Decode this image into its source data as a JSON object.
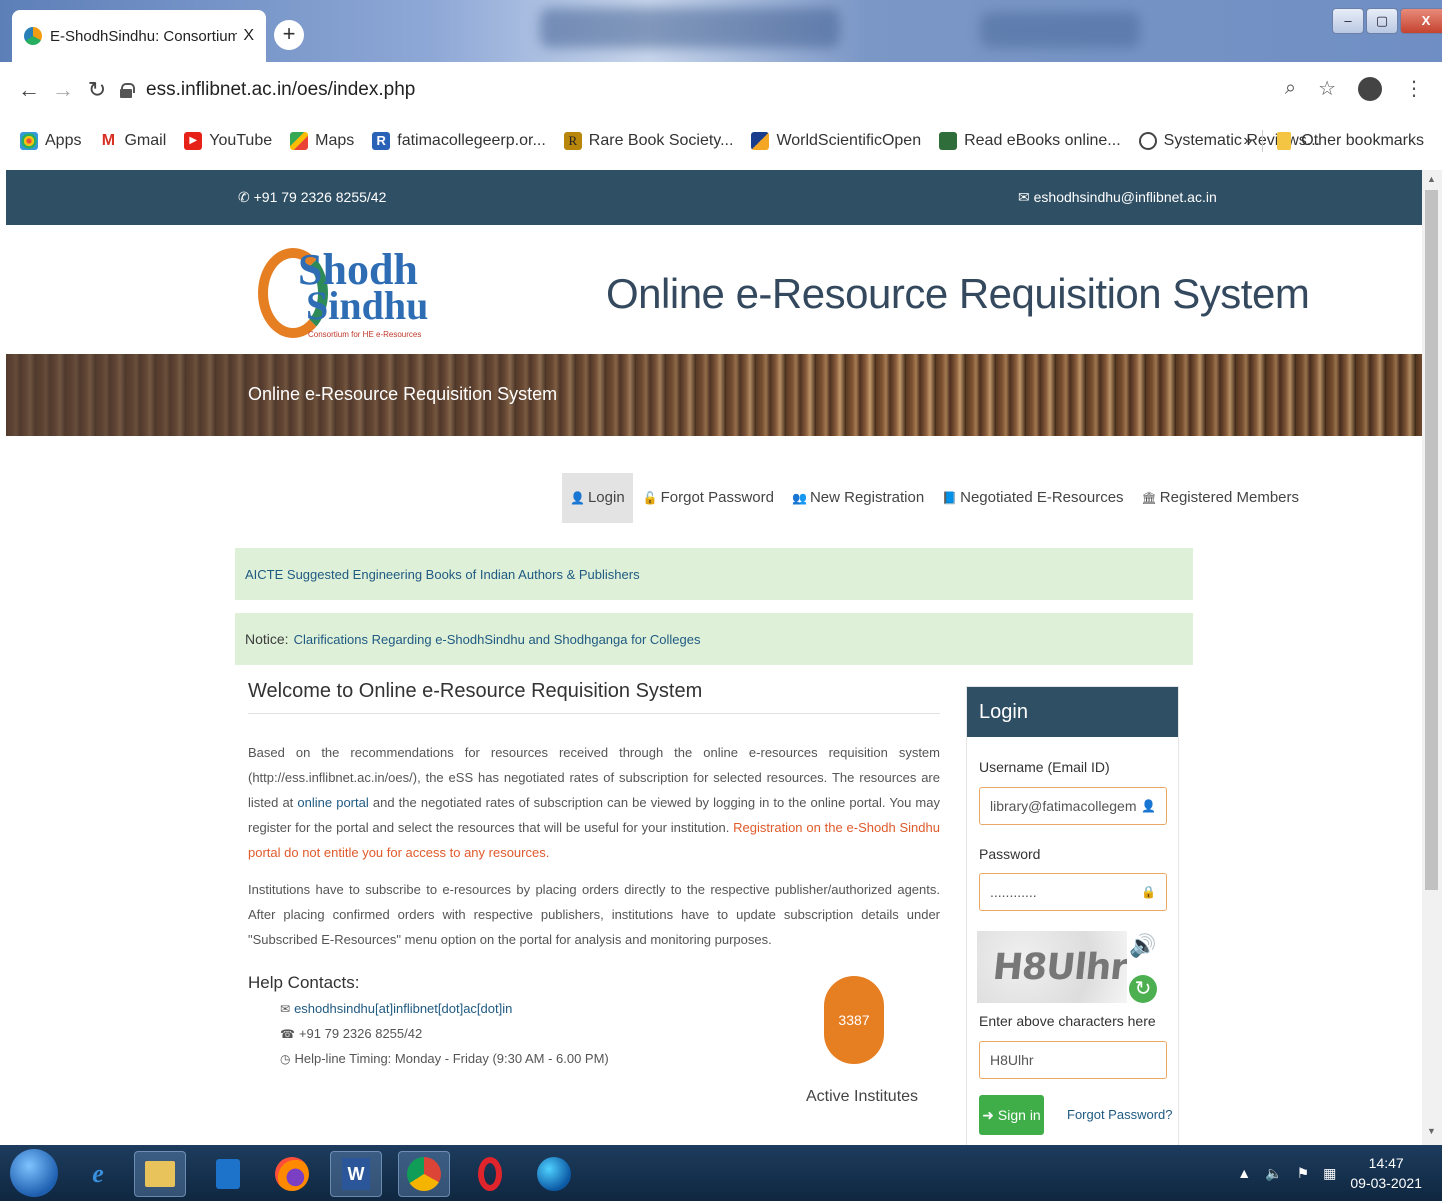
{
  "browser": {
    "tab_title": "E-ShodhSindhu: Consortium for I",
    "tab_close": "X",
    "new_tab": "+",
    "url": "ess.inflibnet.ac.in/oes/index.php",
    "bookmarks": [
      "Apps",
      "Gmail",
      "YouTube",
      "Maps",
      "fatimacollegeerp.or...",
      "Rare Book Society...",
      "WorldScientificOpen",
      "Read eBooks online...",
      "Systematic Reviews..."
    ],
    "bookmarks_more": "»",
    "other_bookmarks": "Other bookmarks"
  },
  "topbar": {
    "phone": "+91 79 2326 8255/42",
    "email": "eshodhsindhu@inflibnet.ac.in"
  },
  "header": {
    "title": "Online e-Resource Requisition System",
    "banner_text": "Online e-Resource Requisition System",
    "logo_line1a": "Sh",
    "logo_line1b": "odh",
    "logo_line2": "Sindhu",
    "logo_tagline": "Consortium for HE e-Resources"
  },
  "nav": {
    "items": [
      "Login",
      "Forgot Password",
      "New Registration",
      "Negotiated E-Resources",
      "Registered Members"
    ]
  },
  "notices": {
    "aicte": "AICTE Suggested Engineering Books of Indian Authors & Publishers",
    "notice_label": "Notice:",
    "notice_text": "Clarifications Regarding e-ShodhSindhu and Shodhganga for Colleges"
  },
  "welcome": {
    "title": "Welcome to Online e-Resource Requisition System",
    "p1_a": "Based on the recommendations for resources received through the online e-resources requisition system (http://ess.inflibnet.ac.in/oes/), the eSS has negotiated rates of subscription for selected resources. The resources are listed at",
    "p1_link": "online portal",
    "p1_b": "and the negotiated rates of subscription can be viewed by logging in to the online portal. You may register for the portal and select the resources that will be useful for your institution.",
    "p1_warn": "Registration on the e-Shodh Sindhu portal do not entitle you for access to any resources.",
    "p2": "Institutions have to subscribe to e-resources by placing orders directly to the respective publisher/authorized agents. After placing confirmed orders with respective publishers, institutions have to update subscription details under \"Subscribed E-Resources\" menu option on the portal for analysis and monitoring purposes."
  },
  "help": {
    "title": "Help Contacts:",
    "email": "eshodhsindhu[at]inflibnet[dot]ac[dot]in",
    "phone": "+91 79 2326 8255/42",
    "timing": "Help-line Timing: Monday - Friday (9:30 AM - 6.00 PM)"
  },
  "stats": {
    "active_count": "3387",
    "active_label": "Active Institutes"
  },
  "login": {
    "title": "Login",
    "username_label": "Username (Email ID)",
    "username_value": "library@fatimacollegem",
    "password_label": "Password",
    "password_value": "............",
    "captcha_text": "H8Ulhr",
    "captcha_label": "Enter above characters here",
    "captcha_value": "H8Ulhr",
    "signin_label": "Sign in",
    "forgot_label": "Forgot Password?"
  },
  "taskbar": {
    "time": "14:47",
    "date": "09-03-2021"
  },
  "colors": {
    "header_bg": "#2f4f64",
    "accent_orange": "#e67e22",
    "notice_bg": "#dff0d8",
    "signin_green": "#3fae49"
  }
}
